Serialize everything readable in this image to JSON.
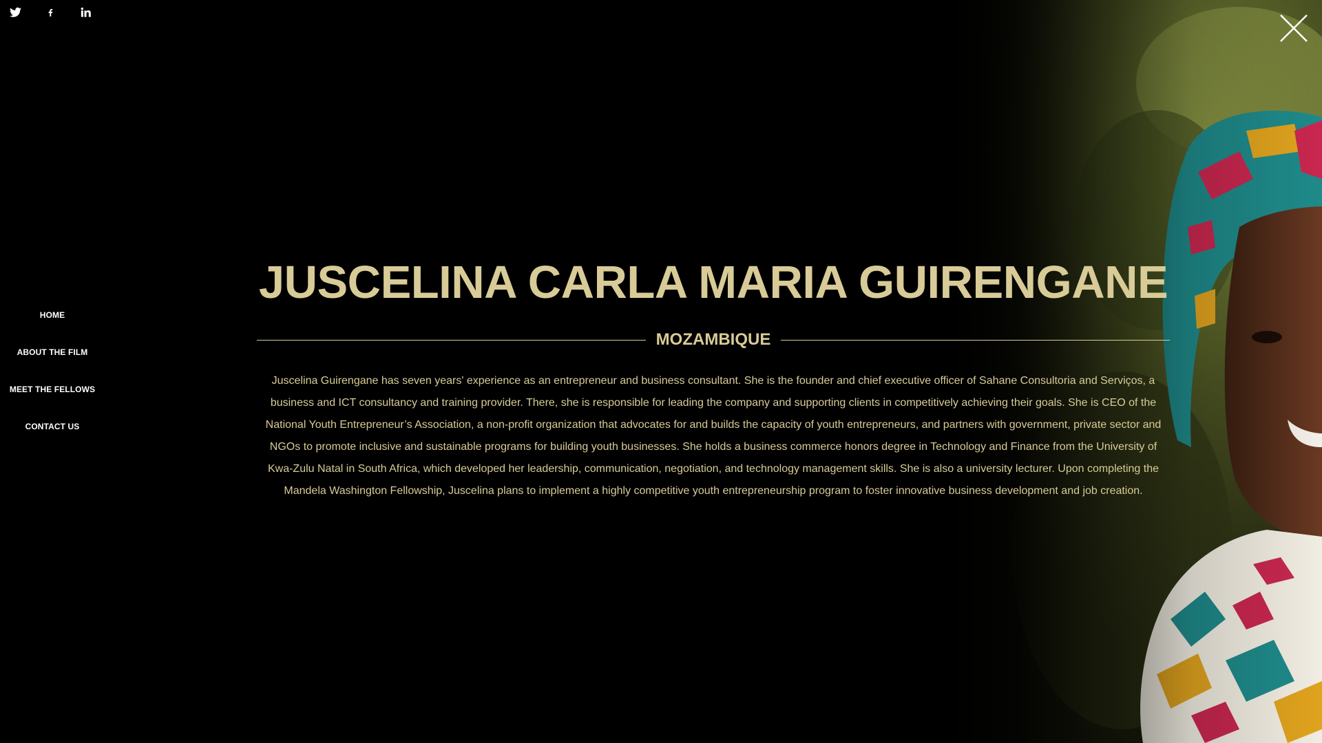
{
  "social": {
    "items": [
      {
        "name": "twitter-icon",
        "label": "Twitter"
      },
      {
        "name": "facebook-icon",
        "label": "Facebook"
      },
      {
        "name": "linkedin-icon",
        "label": "LinkedIn"
      }
    ]
  },
  "nav": {
    "items": [
      {
        "label": "HOME"
      },
      {
        "label": "ABOUT THE FILM"
      },
      {
        "label": "MEET THE FELLOWS"
      },
      {
        "label": "CONTACT US"
      }
    ]
  },
  "profile": {
    "name": "JUSCELINA CARLA MARIA GUIRENGANE",
    "country": "MOZAMBIQUE",
    "bio": "Juscelina Guirengane has seven years' experience as an entrepreneur and business consultant. She is the founder and chief executive officer of Sahane Consultoria and Serviços, a business and ICT consultancy and training provider. There, she is responsible for leading the company and supporting clients in competitively achieving their goals. She is CEO of the National Youth Entrepreneur’s Association, a non-profit organization that advocates for and builds the capacity of youth entrepreneurs, and partners with government, private sector and NGOs to promote inclusive and sustainable programs for building youth businesses. She holds a business commerce honors degree in Technology and Finance from the University of Kwa-Zulu Natal in South Africa, which developed her leadership, communication, negotiation, and technology management skills. She is also a university lecturer. Upon completing the Mandela Washington Fellowship, Juscelina plans to implement a highly competitive youth entrepreneurship program to foster innovative business development and job creation."
  },
  "colors": {
    "accent": "#d8cb97",
    "background": "#000000",
    "nav_text": "#ffffff"
  },
  "close": {
    "icon": "close-icon"
  }
}
